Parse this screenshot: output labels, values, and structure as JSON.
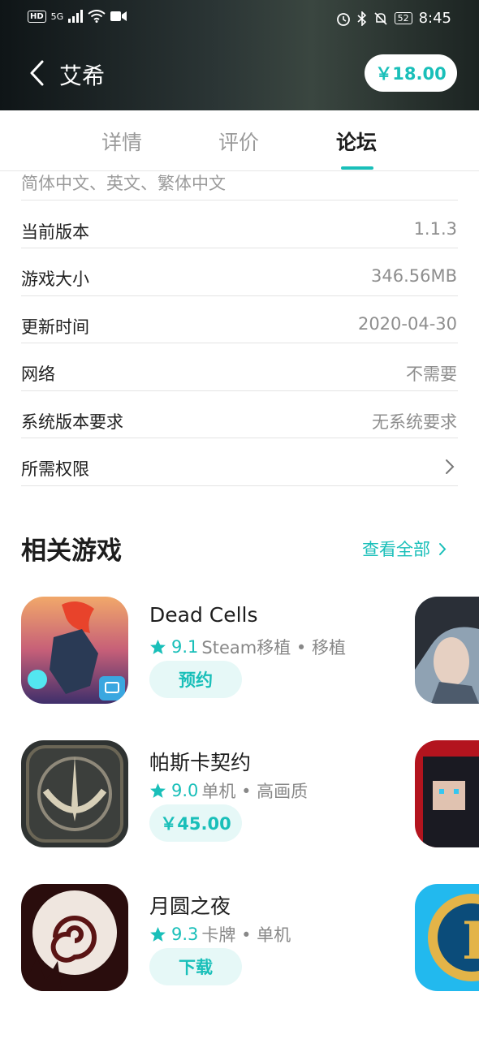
{
  "status_bar": {
    "hd": "HD",
    "network": "5G",
    "battery": "52",
    "time": "8:45"
  },
  "header": {
    "title": "艾希",
    "price": "￥18.00"
  },
  "tabs": [
    {
      "label": "详情"
    },
    {
      "label": "评价"
    },
    {
      "label": "论坛"
    }
  ],
  "info": {
    "languages": "简体中文、英文、繁体中文",
    "rows": [
      {
        "label": "当前版本",
        "value": "1.1.3"
      },
      {
        "label": "游戏大小",
        "value": "346.56MB"
      },
      {
        "label": "更新时间",
        "value": "2020-04-30"
      },
      {
        "label": "网络",
        "value": "不需要"
      },
      {
        "label": "系统版本要求",
        "value": "无系统要求"
      },
      {
        "label": "所需权限",
        "value": ""
      }
    ]
  },
  "related": {
    "title": "相关游戏",
    "see_all": "查看全部",
    "games": [
      {
        "name": "Dead Cells",
        "score": "9.1",
        "tags": "Steam移植 • 移植",
        "button": "预约"
      },
      {
        "name": "帕斯卡契约",
        "score": "9.0",
        "tags": "单机 • 高画质",
        "button": "￥45.00"
      },
      {
        "name": "月圆之夜",
        "score": "9.3",
        "tags": "卡牌 • 单机",
        "button": "下载"
      }
    ]
  },
  "colors": {
    "accent": "#19bfb9",
    "button_bg": "#e6f8f7",
    "header_bg": "#1c2422"
  }
}
